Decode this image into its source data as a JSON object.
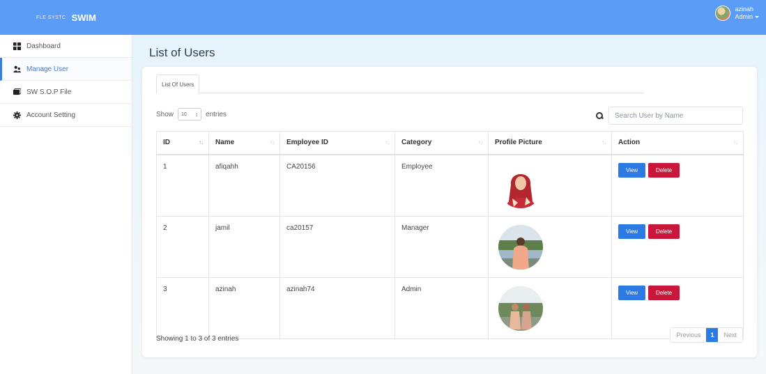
{
  "header": {
    "brand_small": "FLE SYSTC",
    "brand_name": "SWIM",
    "user_name": "azinah",
    "user_role": "Admin"
  },
  "sidebar": {
    "items": [
      {
        "label": "Dashboard",
        "icon": "dashboard-icon",
        "active": false
      },
      {
        "label": "Manage User",
        "icon": "users-icon",
        "active": true
      },
      {
        "label": "SW S.O.P File",
        "icon": "folder-icon",
        "active": false
      },
      {
        "label": "Account Setting",
        "icon": "gear-icon",
        "active": false
      }
    ]
  },
  "page": {
    "title": "List of Users",
    "tab_label": "List Of Users"
  },
  "controls": {
    "show_label": "Show",
    "entries_label": "entries",
    "page_length": "10",
    "search_placeholder": "Search User by Name"
  },
  "table": {
    "headers": [
      "ID",
      "Name",
      "Employee ID",
      "Category",
      "Profile Picture",
      "Action"
    ],
    "rows": [
      {
        "id": "1",
        "name": "afiqahh",
        "employee_id": "CA20156",
        "category": "Employee",
        "view": "View",
        "delete": "Delete"
      },
      {
        "id": "2",
        "name": "jamil",
        "employee_id": "ca20157",
        "category": "Manager",
        "view": "View",
        "delete": "Delete"
      },
      {
        "id": "3",
        "name": "azinah",
        "employee_id": "azinah74",
        "category": "Admin",
        "view": "View",
        "delete": "Delete"
      }
    ]
  },
  "footer": {
    "info": "Showing 1 to 3 of 3 entries",
    "previous": "Previous",
    "current_page": "1",
    "next": "Next"
  },
  "colors": {
    "topbar": "#5b9cf6",
    "accent": "#2c7be5",
    "danger": "#c9173b",
    "active_nav": "#3b7ddd"
  }
}
